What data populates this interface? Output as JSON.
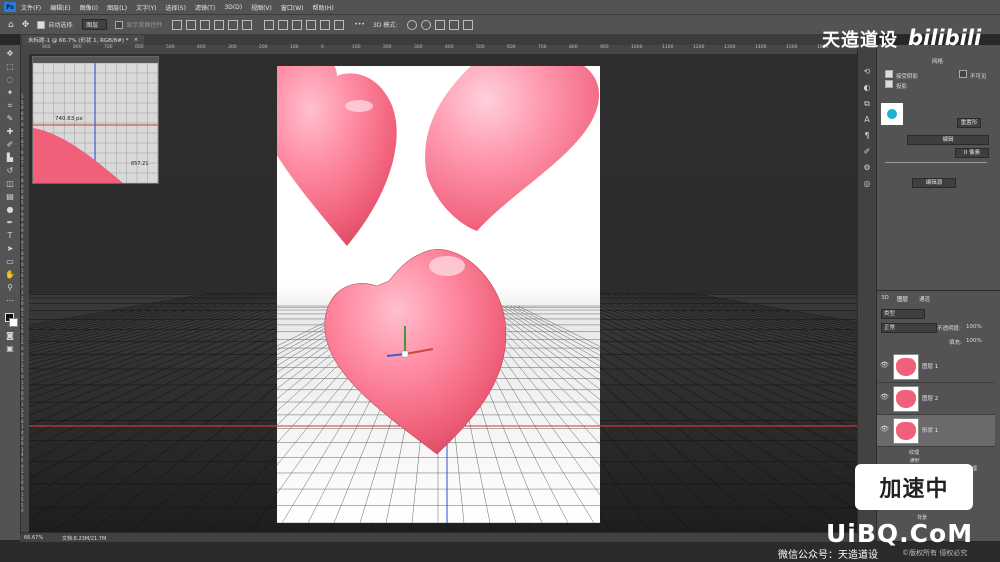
{
  "menu": [
    "文件(F)",
    "编辑(E)",
    "图像(I)",
    "图层(L)",
    "文字(Y)",
    "选择(S)",
    "滤镜(T)",
    "3D(D)",
    "视图(V)",
    "窗口(W)",
    "帮助(H)"
  ],
  "options": {
    "auto_select": "自动选择:",
    "auto_select_value": "图层",
    "transform": "显示变换控件",
    "mode_3d": "3D 模式:"
  },
  "tab": {
    "title": "未标题-1 @ 66.7% (形状 1, RGB/8#) *",
    "close": "×"
  },
  "ruler_h": [
    "900",
    "800",
    "700",
    "600",
    "500",
    "400",
    "300",
    "200",
    "100",
    "0",
    "100",
    "200",
    "300",
    "400",
    "500",
    "600",
    "700",
    "800",
    "900",
    "1000",
    "1100",
    "1200",
    "1300",
    "1400",
    "1500",
    "1600",
    "1700",
    "1800"
  ],
  "ruler_v": [
    "1",
    "5",
    "0",
    "6",
    "0",
    "0",
    "6",
    "5",
    "0",
    "7",
    "0",
    "0",
    "7",
    "5",
    "0",
    "8",
    "0",
    "0",
    "8",
    "5",
    "0",
    "9",
    "0",
    "0",
    "9",
    "5",
    "0",
    "1",
    "0",
    "0",
    "0",
    "1",
    "0",
    "5",
    "0",
    "1",
    "1",
    "0",
    "0",
    "1",
    "1",
    "5",
    "0",
    "1",
    "2",
    "0",
    "0",
    "1",
    "2",
    "5",
    "0",
    "1",
    "3",
    "0",
    "0",
    "1",
    "3",
    "5",
    "0",
    "1",
    "4",
    "0",
    "0",
    "1",
    "4",
    "5",
    "0",
    "1",
    "5",
    "0",
    "0",
    "1",
    "5",
    "5",
    "0"
  ],
  "navigator": {
    "coord_h": "740.63 px",
    "coord_v": "657.21"
  },
  "properties": {
    "tab_net": "网格",
    "cast_shadow": "接受阴影",
    "not_visible": "不可见",
    "shadow": "投影",
    "new_btn": "重置形",
    "distort": "编辑",
    "px_value": "0 像素",
    "edit_source": "编辑源"
  },
  "layers_tabs": [
    "3D",
    "图层",
    "通道"
  ],
  "layer_kind": "类型",
  "blend_mode": "正常",
  "opacity_label": "不透明度:",
  "opacity_value": "100%",
  "fill_label": "填充:",
  "fill_value": "100%",
  "layers": [
    {
      "name": "图层 1"
    },
    {
      "name": "图层 2"
    },
    {
      "name": "形状 1"
    }
  ],
  "sublayers": [
    "纹理",
    "漫射",
    "纹理"
  ],
  "background_layer": "背景",
  "status": {
    "zoom": "66.67%",
    "doc": "文档:8.23M/21.7M"
  },
  "overlays": {
    "badge": "加速中",
    "watermark": "天造道设",
    "bili": "bilibili",
    "uibq": "UiBQ.CoM",
    "wechat": "微信公众号：天造道设",
    "copyright": "©版权所有 侵权必究"
  },
  "colors": {
    "accent": "#2a7bd3",
    "heart": "#f0607a",
    "grid_red": "#c73b3b",
    "grid_blue": "#2f4bd6"
  }
}
